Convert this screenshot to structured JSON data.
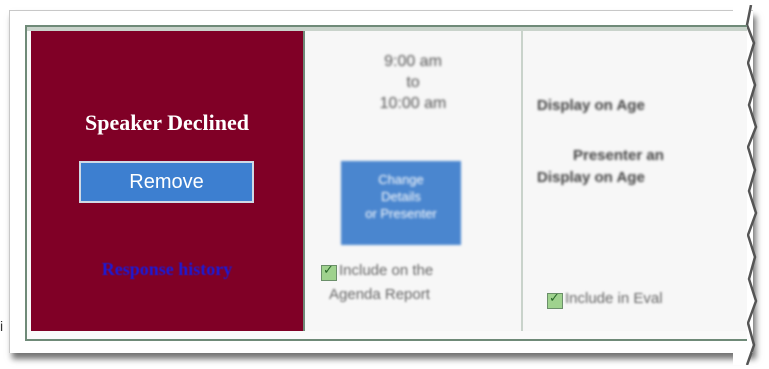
{
  "stray_glyph": "i",
  "status_cell": {
    "title": "Speaker Declined",
    "remove_button": "Remove",
    "response_history_link": "Response history",
    "background_color": "#800026"
  },
  "time_cell": {
    "lines": [
      "9:00 am",
      "to",
      "10:00 am"
    ],
    "change_button_lines": [
      "Change",
      "Details",
      "or Presenter"
    ],
    "include_agenda": {
      "checked": true,
      "label_lines": [
        "Include on the",
        "Agenda Report"
      ]
    }
  },
  "display_cell": {
    "line1": "Display on Age",
    "line2": "Presenter an",
    "line3": "Display on Age",
    "include_eval": {
      "checked": true,
      "label": "Include in Eval"
    }
  }
}
